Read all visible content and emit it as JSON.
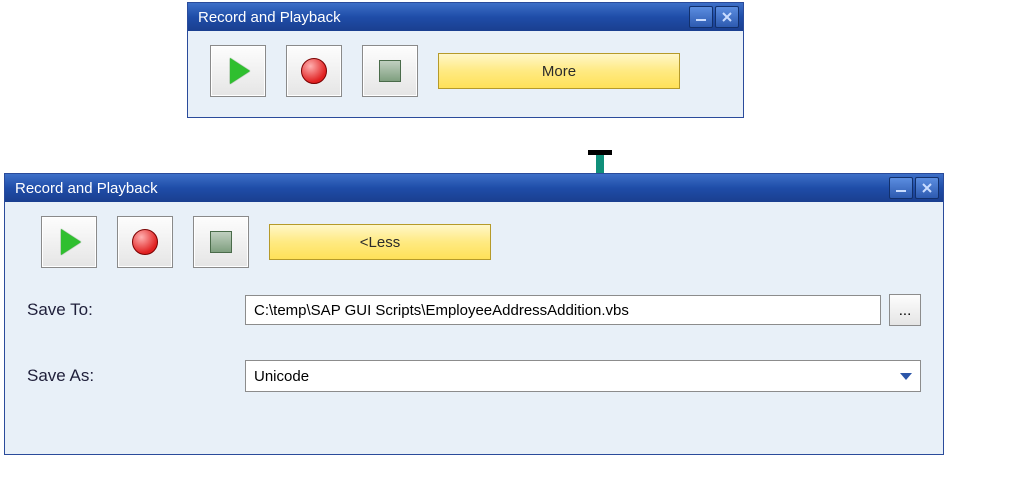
{
  "window_small": {
    "title": "Record and Playback",
    "more_label": "More"
  },
  "window_large": {
    "title": "Record and Playback",
    "less_label": "<Less",
    "save_to_label": "Save To:",
    "save_to_value": "C:\\temp\\SAP GUI Scripts\\EmployeeAddressAddition.vbs",
    "browse_label": "...",
    "save_as_label": "Save As:",
    "save_as_value": "Unicode"
  }
}
